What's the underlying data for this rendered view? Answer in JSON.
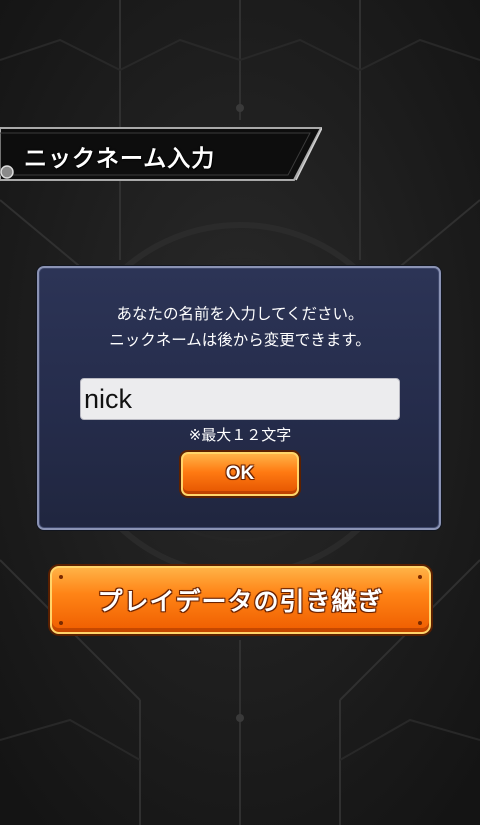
{
  "header": {
    "title": "ニックネーム入力"
  },
  "dialog": {
    "message_line1": "あなたの名前を入力してください。",
    "message_line2": "ニックネームは後から変更できます。",
    "name_input_value": "nick",
    "max_length_note": "※最大１２文字",
    "ok_label": "OK"
  },
  "transfer_button_label": "プレイデータの引き継ぎ",
  "colors": {
    "background": "#1a1a1a",
    "dialog_bg": "#252c4b",
    "dialog_border": "#8b93b4",
    "button_orange": "#ff7a12",
    "button_border": "#ffd56a",
    "input_bg": "#ececee"
  },
  "icons": [
    "banner-bolt-icon"
  ]
}
